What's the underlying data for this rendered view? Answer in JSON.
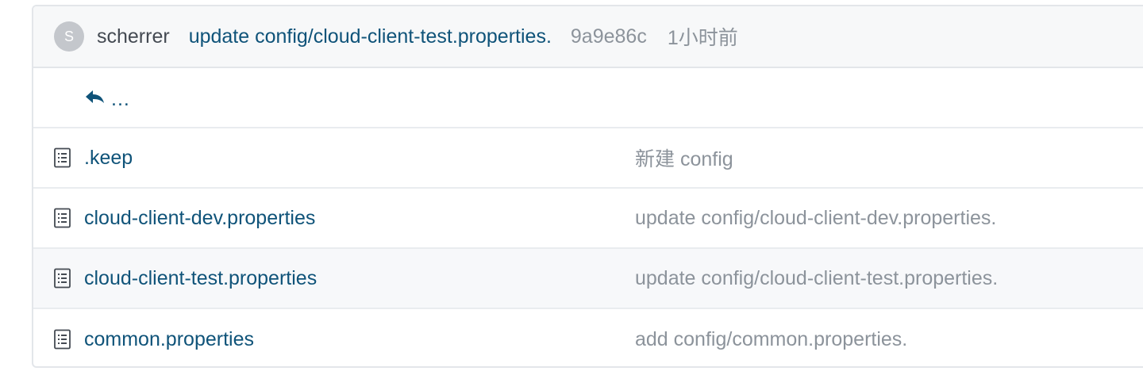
{
  "last_commit": {
    "avatar_initial": "S",
    "author": "scherrer",
    "message": "update config/cloud-client-test.properties.",
    "sha": "9a9e86c",
    "time": "1小时前"
  },
  "parent_dir": {
    "label": "..."
  },
  "files": [
    {
      "name": ".keep",
      "commit_message": "新建 config"
    },
    {
      "name": "cloud-client-dev.properties",
      "commit_message": "update config/cloud-client-dev.properties."
    },
    {
      "name": "cloud-client-test.properties",
      "commit_message": "update config/cloud-client-test.properties."
    },
    {
      "name": "common.properties",
      "commit_message": "add config/common.properties."
    }
  ],
  "colors": {
    "link": "#0f5379",
    "muted": "#8c939b",
    "border": "#e3e6ea",
    "header_bg": "#f7f8f9",
    "hover_bg": "#f7f8fa"
  },
  "icons": {
    "parent": "reply-arrow-icon",
    "file": "file-text-icon"
  }
}
